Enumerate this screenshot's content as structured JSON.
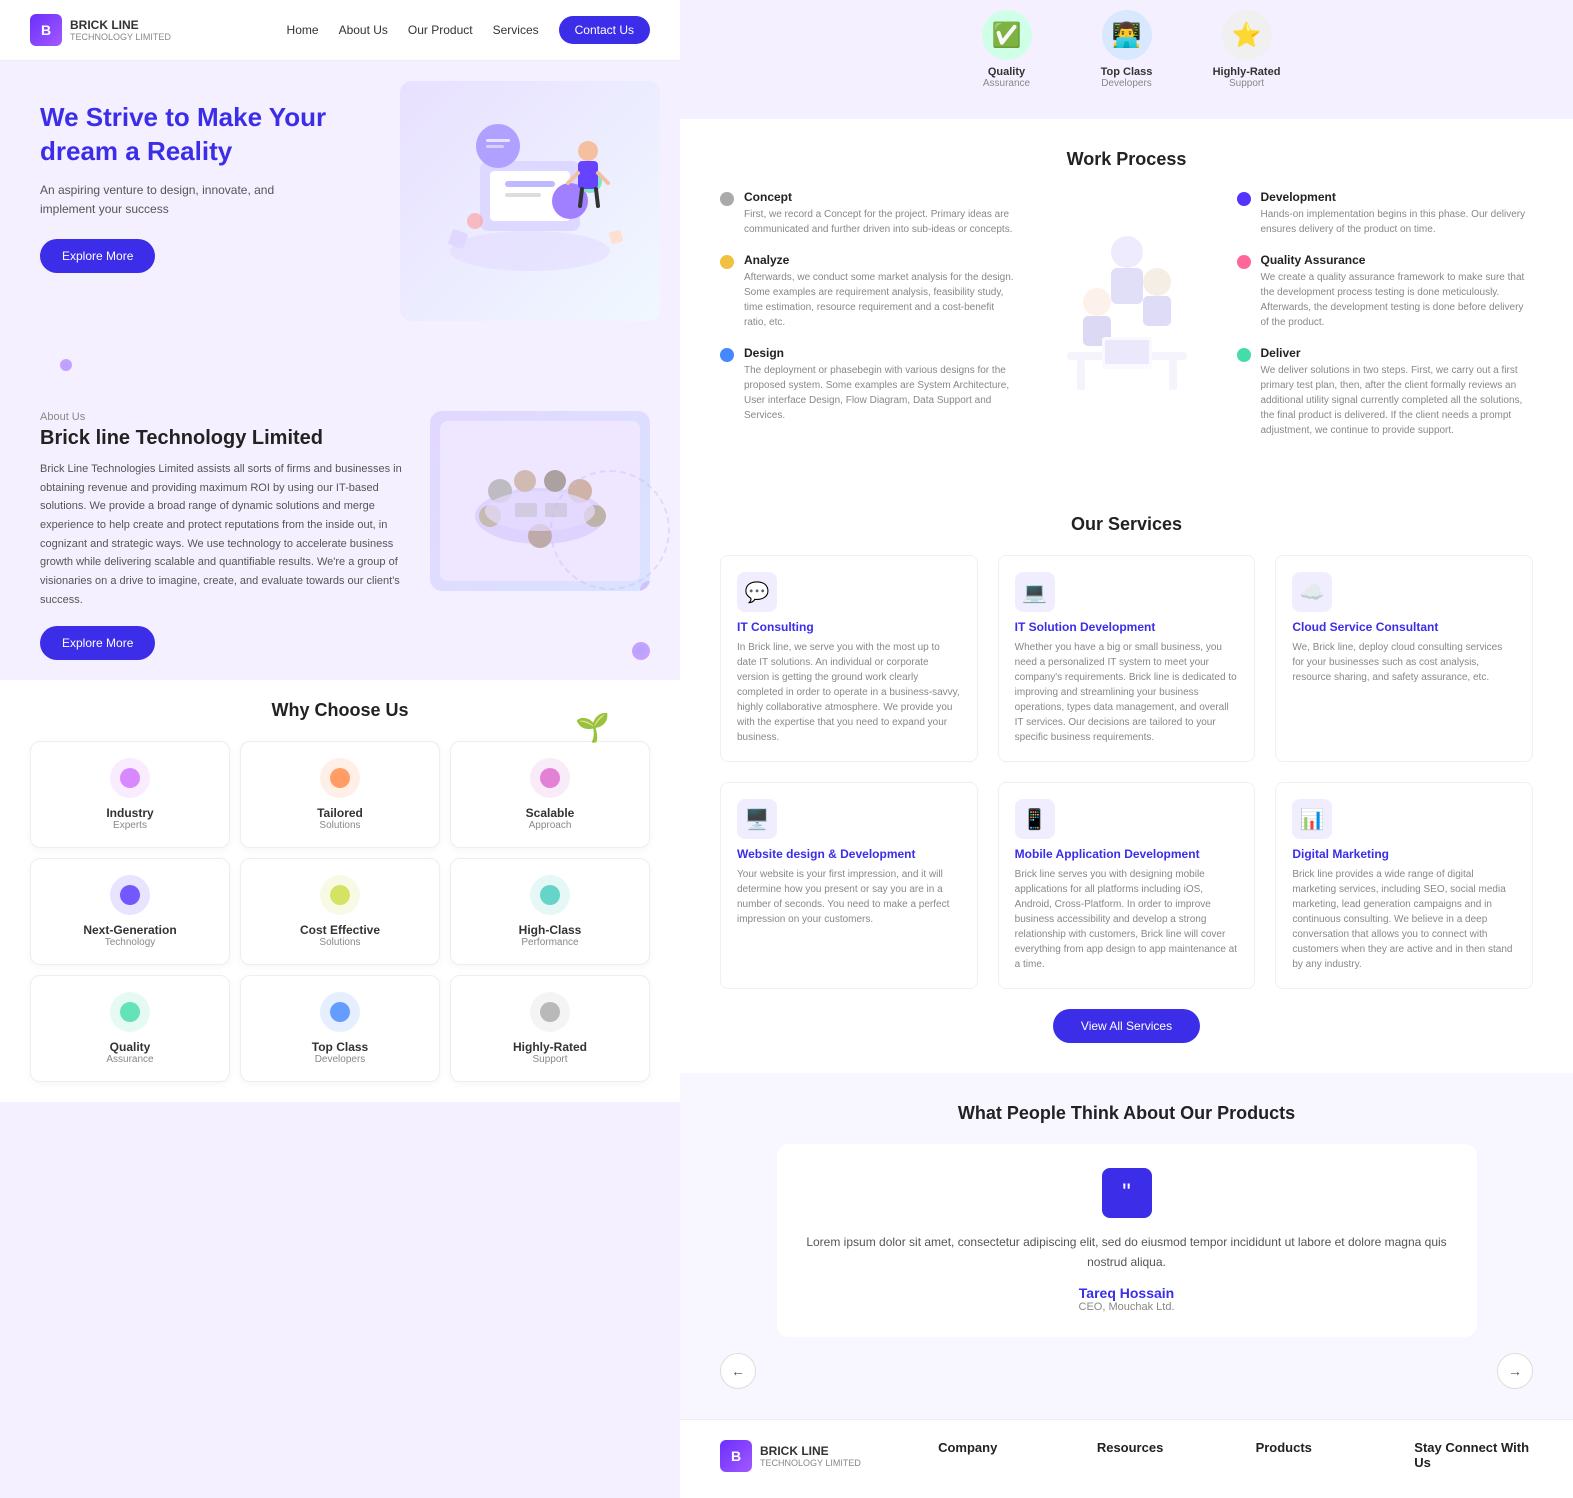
{
  "nav": {
    "logo_name": "BRICK LINE",
    "logo_sub": "TECHNOLOGY LIMITED",
    "links": [
      "Home",
      "About Us",
      "Our Product",
      "Services"
    ],
    "cta": "Contact Us"
  },
  "hero": {
    "title": "We Strive to Make Your dream a Reality",
    "subtitle": "An aspiring venture to design, innovate, and implement your success",
    "cta": "Explore More"
  },
  "about": {
    "label": "About Us",
    "title": "Brick line Technology Limited",
    "body": "Brick Line Technologies Limited assists all sorts of firms and businesses in obtaining revenue and providing maximum ROI by using our IT-based solutions. We provide a broad range of dynamic solutions and merge experience to help create and protect reputations from the inside out, in cognizant and strategic ways. We use technology to accelerate business growth while delivering scalable and quantifiable results. We're a group of visionaries on a drive to imagine, create, and evaluate towards our client's success.",
    "cta": "Explore More"
  },
  "why": {
    "title": "Why Choose Us",
    "cards": [
      {
        "title": "Industry",
        "sub": "Experts",
        "color": "#d070ff"
      },
      {
        "title": "Tailored",
        "sub": "Solutions",
        "color": "#ff8844"
      },
      {
        "title": "Scalable",
        "sub": "Approach",
        "color": "#dd66cc"
      },
      {
        "title": "Next-Generation",
        "sub": "Technology",
        "color": "#5533ff"
      },
      {
        "title": "Cost Effective",
        "sub": "Solutions",
        "color": "#ccdd44"
      },
      {
        "title": "High-Class",
        "sub": "Performance",
        "color": "#44ccbb"
      },
      {
        "title": "Quality",
        "sub": "Assurance",
        "color": "#44ddaa"
      },
      {
        "title": "Top Class",
        "sub": "Developers",
        "color": "#4488ff"
      },
      {
        "title": "Highly-Rated",
        "sub": "Support",
        "color": "#aaaaaa"
      }
    ]
  },
  "top_cards": [
    {
      "label1": "Quality",
      "label2": "Assurance",
      "color": "#44ddaa"
    },
    {
      "label1": "Top Class",
      "label2": "Developers",
      "color": "#4488ff"
    },
    {
      "label1": "Highly-Rated",
      "label2": "Support",
      "color": "#aaaaaa"
    }
  ],
  "work_process": {
    "title": "Work Process",
    "steps_left": [
      {
        "name": "Concept",
        "desc": "First, we record a Concept for the project. Primary ideas are communicated and further driven into sub-ideas or concepts.",
        "color": "#aaa"
      },
      {
        "name": "Analyze",
        "desc": "Afterwards, we conduct some market analysis for the design. Some examples are requirement analysis, feasibility study, time estimation, resource requirement and a cost-benefit ratio, etc.",
        "color": "#f0c040"
      },
      {
        "name": "Design",
        "desc": "The deployment or phasebegin with various designs for the proposed system. Some examples are System Architecture, User interface Design, Flow Diagram, Data Support and Services.",
        "color": "#4488ff"
      }
    ],
    "steps_right": [
      {
        "name": "Development",
        "desc": "Hands-on implementation begins in this phase. Our delivery ensures delivery of the product on time.",
        "color": "#5533ff"
      },
      {
        "name": "Quality Assurance",
        "desc": "We create a quality assurance framework to make sure that the development process testing is done meticulously. Afterwards, the development testing is done before delivery of the product.",
        "color": "#ff6699"
      },
      {
        "name": "Deliver",
        "desc": "We deliver solutions in two steps. First, we carry out a first primary test plan, then, after the client formally reviews an additional utility signal currently completed all the solutions, the final product is delivered. If the client needs a prompt adjustment, we continue to provide support.",
        "color": "#44ddaa"
      }
    ]
  },
  "services": {
    "title": "Our Services",
    "items": [
      {
        "name": "IT Consulting",
        "desc": "In Brick line, we serve you with the most up to date IT solutions. An individual or corporate version is getting the ground work clearly completed in order to operate in a business-savvy, highly collaborative atmosphere. We provide you with the expertise that you need to expand your business.",
        "icon": "💬"
      },
      {
        "name": "IT Solution Development",
        "desc": "Whether you have a big or small business, you need a personalized IT system to meet your company's requirements. Brick line is dedicated to improving and streamlining your business operations, types data management, and overall IT services. Our decisions are tailored to your specific business requirements.",
        "icon": "💻"
      },
      {
        "name": "Cloud Service Consultant",
        "desc": "We, Brick line, deploy cloud consulting services for your businesses such as cost analysis, resource sharing, and safety assurance, etc.",
        "icon": "☁️"
      },
      {
        "name": "Website design & Development",
        "desc": "Your website is your first impression, and it will determine how you present or say you are in a number of seconds. You need to make a perfect impression on your customers.",
        "icon": "🖥️"
      },
      {
        "name": "Mobile Application Development",
        "desc": "Brick line serves you with designing mobile applications for all platforms including iOS, Android, Cross-Platform. In order to improve business accessibility and develop a strong relationship with customers, Brick line will cover everything from app design to app maintenance at a time.",
        "icon": "📱"
      },
      {
        "name": "Digital Marketing",
        "desc": "Brick line provides a wide range of digital marketing services, including SEO, social media marketing, lead generation campaigns and in continuous consulting. We believe in a deep conversation that allows you to connect with customers when they are active and in then stand by any industry.",
        "icon": "📊"
      }
    ],
    "view_all": "View All Services"
  },
  "testimonial": {
    "title": "What People Think About Our Products",
    "quote": "Lorem ipsum dolor sit amet, consectetur adipiscing elit, sed do eiusmod tempor incididunt ut labore et dolore magna quis nostrud aliqua.",
    "author": "Tareq Hossain",
    "role": "CEO, Mouchak Ltd."
  },
  "footer": {
    "brand_name": "BRICK LINE",
    "brand_sub": "TECHNOLOGY LIMITED",
    "cols": [
      {
        "title": "Company",
        "items": []
      },
      {
        "title": "Resources",
        "items": []
      },
      {
        "title": "Products",
        "items": []
      },
      {
        "title": "Stay Connect With Us",
        "items": []
      }
    ]
  }
}
